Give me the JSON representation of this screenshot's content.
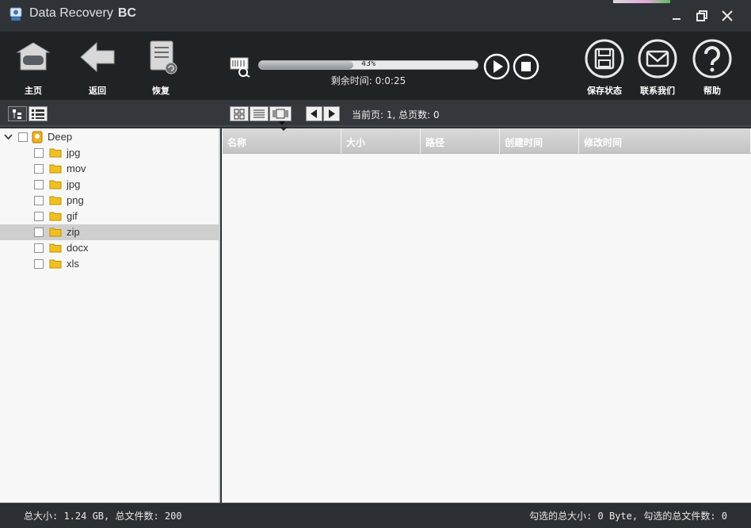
{
  "window": {
    "title": "Data Recovery",
    "title_suffix": "BC"
  },
  "toolbar": {
    "home_label": "主页",
    "back_label": "返回",
    "recover_label": "恢复",
    "save_state_label": "保存状态",
    "contact_label": "联系我们",
    "help_label": "帮助"
  },
  "scan": {
    "progress_percent": 43,
    "progress_text": "43%",
    "remaining": "剩余时间: 0:0:25"
  },
  "subbar": {
    "page_info": "当前页: 1, 总页数: 0"
  },
  "tree": {
    "root_label": "Deep",
    "items": [
      {
        "label": "jpg"
      },
      {
        "label": "mov"
      },
      {
        "label": "jpg"
      },
      {
        "label": "png"
      },
      {
        "label": "gif"
      },
      {
        "label": "zip",
        "selected": true
      },
      {
        "label": "docx"
      },
      {
        "label": "xls"
      }
    ]
  },
  "table": {
    "columns": [
      "名称",
      "大小",
      "路径",
      "创建时间",
      "修改时间"
    ]
  },
  "status": {
    "left": "总大小: 1.24 GB, 总文件数: 200",
    "right": "勾选的总大小: 0 Byte, 勾选的总文件数: 0"
  },
  "colors": {
    "toolbar_bg": "#202326",
    "folder": "#f0c020",
    "selected_row": "#cfcfcf"
  }
}
